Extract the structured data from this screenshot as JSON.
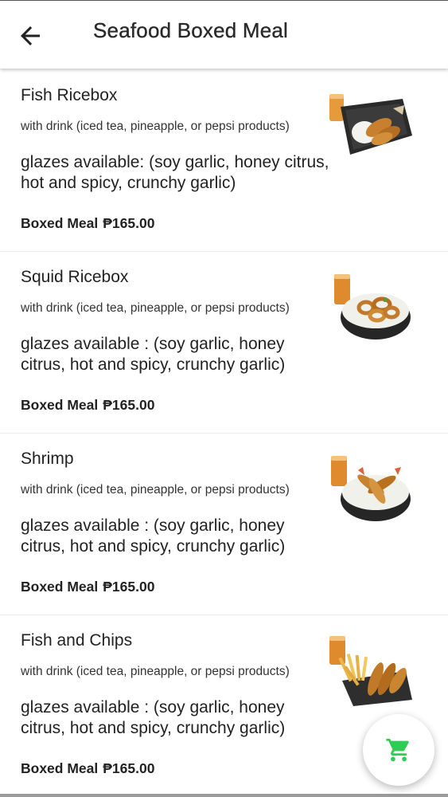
{
  "header": {
    "title": "Seafood Boxed Meal"
  },
  "items": [
    {
      "title": "Fish Ricebox",
      "drink": "with drink (iced tea, pineapple, or pepsi products)",
      "glazes": "glazes available: (soy garlic, honey citrus, hot and spicy, crunchy garlic)",
      "price_label": "Boxed Meal",
      "price": "₱165.00",
      "image": "fish-ricebox-image"
    },
    {
      "title": "Squid Ricebox",
      "drink": "with drink (iced tea, pineapple, or pepsi products)",
      "glazes": "glazes available : (soy garlic, honey citrus, hot and spicy, crunchy garlic)",
      "price_label": "Boxed Meal",
      "price": "₱165.00",
      "image": "squid-ricebox-image"
    },
    {
      "title": "Shrimp",
      "drink": "with drink (iced tea, pineapple, or pepsi products)",
      "glazes": "glazes available : (soy garlic, honey citrus, hot and spicy, crunchy garlic)",
      "price_label": "Boxed Meal",
      "price": "₱165.00",
      "image": "shrimp-ricebox-image"
    },
    {
      "title": "Fish and Chips",
      "drink": "with drink (iced tea, pineapple, or pepsi products)",
      "glazes": "glazes available : (soy garlic, honey citrus, hot and spicy, crunchy garlic)",
      "price_label": "Boxed Meal",
      "price": "₱165.00",
      "image": "fish-and-chips-image"
    }
  ],
  "icons": {
    "back": "arrow-back-icon",
    "cart": "cart-icon"
  },
  "colors": {
    "cart_accent": "#2ecc52",
    "divider": "#ececec"
  }
}
